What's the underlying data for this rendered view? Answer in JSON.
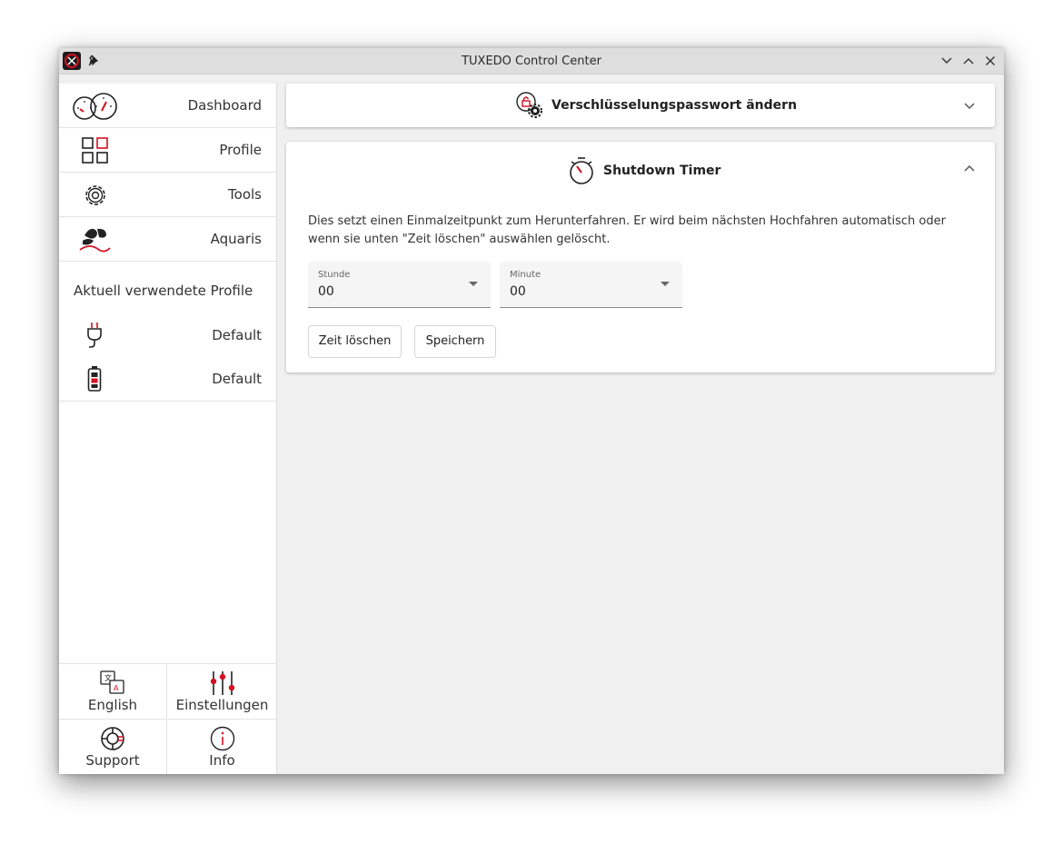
{
  "window": {
    "title": "TUXEDO Control Center"
  },
  "sidebar": {
    "items": [
      {
        "label": "Dashboard",
        "icon": "dashboard-gauges-icon"
      },
      {
        "label": "Profile",
        "icon": "profiles-grid-icon"
      },
      {
        "label": "Tools",
        "icon": "gear-icon"
      },
      {
        "label": "Aquaris",
        "icon": "aquaris-fan-icon"
      }
    ],
    "active_profiles_title": "Aktuell verwendete Profile",
    "active_profiles": [
      {
        "label": "Default",
        "icon": "power-plug-icon"
      },
      {
        "label": "Default",
        "icon": "battery-icon"
      }
    ],
    "bottom": [
      {
        "label": "English",
        "icon": "language-icon"
      },
      {
        "label": "Einstellungen",
        "icon": "sliders-icon"
      },
      {
        "label": "Support",
        "icon": "lifebuoy-icon"
      },
      {
        "label": "Info",
        "icon": "info-icon"
      }
    ]
  },
  "cards": {
    "encryption": {
      "title": "Verschlüsselungspasswort ändern",
      "expanded": false
    },
    "shutdown": {
      "title": "Shutdown Timer",
      "expanded": true,
      "description": "Dies setzt einen Einmalzeitpunkt zum Herunterfahren. Er wird beim nächsten Hochfahren automatisch oder wenn sie unten \"Zeit löschen\" auswählen gelöscht.",
      "hour": {
        "label": "Stunde",
        "value": "00"
      },
      "minute": {
        "label": "Minute",
        "value": "00"
      },
      "clear_button": "Zeit löschen",
      "save_button": "Speichern"
    }
  },
  "colors": {
    "accent": "#d41124",
    "icon": "#222222"
  }
}
